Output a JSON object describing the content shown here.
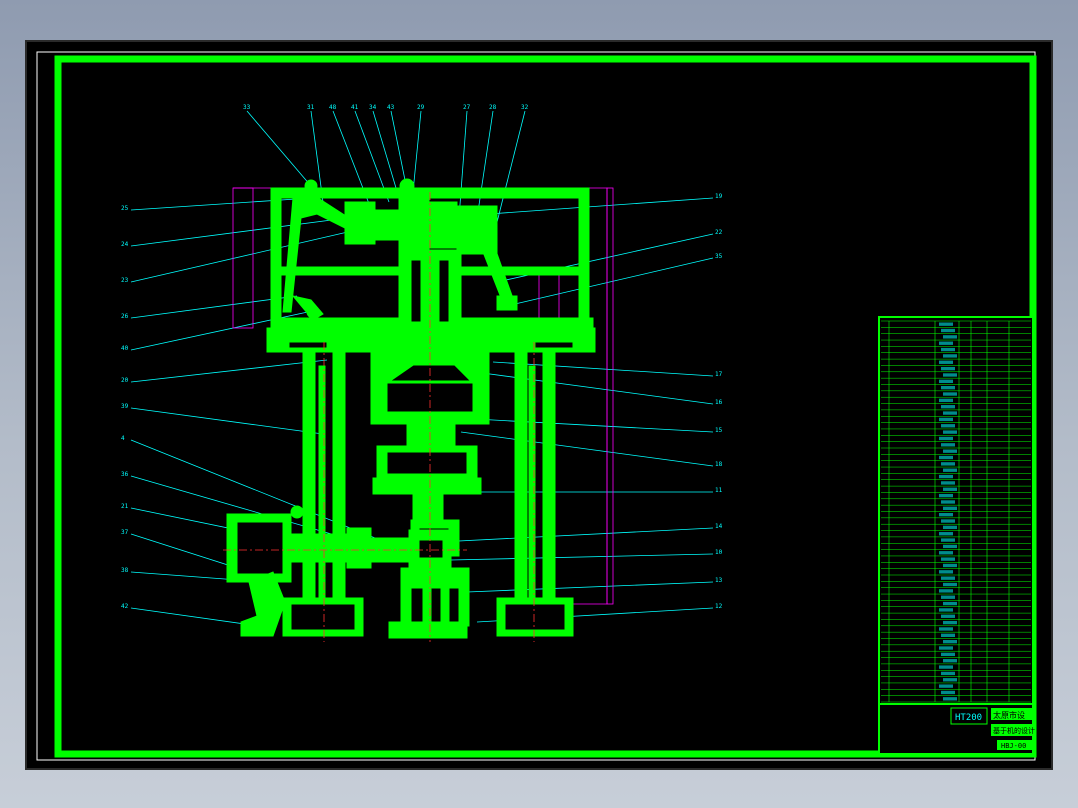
{
  "viewer": {
    "background": "#000000",
    "line_color": "#00ff00",
    "leader_color": "#00ffff",
    "construction_color": "#ff00ff",
    "centerline_color": "#ff3030"
  },
  "drawing": {
    "top_callouts": [
      "33",
      "31",
      "48",
      "41",
      "34",
      "43",
      "29",
      "27",
      "28",
      "32"
    ],
    "left_callouts": [
      "25",
      "24",
      "23",
      "26",
      "40",
      "20",
      "39",
      "4",
      "36",
      "21",
      "37",
      "38",
      "42"
    ],
    "right_callouts": [
      "19",
      "22",
      "35",
      "17",
      "16",
      "15",
      "18",
      "11",
      "14",
      "10",
      "13",
      "12"
    ]
  },
  "title_block": {
    "model_label": "HT200",
    "right_label_1": "太原市设",
    "right_label_2": "基于机的设计",
    "drawing_number": "HBJ-00",
    "parts_table_rows": 60
  }
}
